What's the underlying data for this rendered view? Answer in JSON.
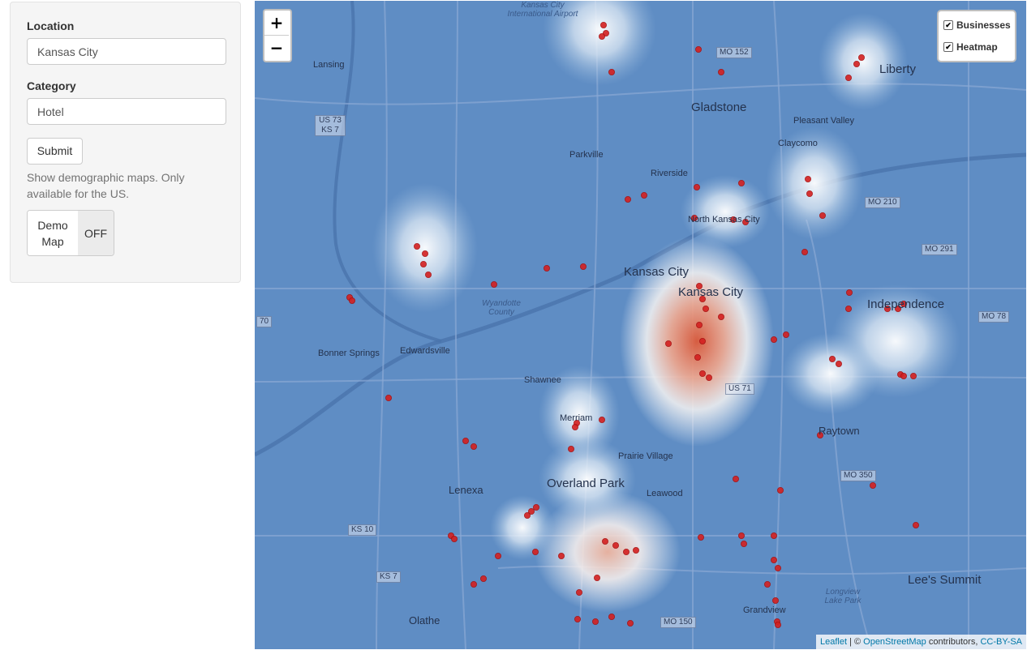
{
  "sidebar": {
    "location_label": "Location",
    "location_value": "Kansas City",
    "category_label": "Category",
    "category_value": "Hotel",
    "submit_label": "Submit",
    "help_text": "Show demographic maps. Only available for the US.",
    "toggle_on_label": "Demo Map",
    "toggle_off_label": "OFF"
  },
  "map": {
    "zoom_in": "+",
    "zoom_out": "−",
    "layers": [
      {
        "label": "Businesses",
        "checked": true
      },
      {
        "label": "Heatmap",
        "checked": true
      }
    ],
    "attribution": {
      "leaflet": "Leaflet",
      "sep": " | © ",
      "osm": "OpenStreetMap",
      "contrib": " contributors, ",
      "license": "CC-BY-SA"
    },
    "places": [
      "Kansas City",
      "Kansas City",
      "North Kansas City",
      "Gladstone",
      "Liberty",
      "Pleasant Valley",
      "Claycomo",
      "Riverside",
      "Parkville",
      "Independence",
      "Raytown",
      "Lee's Summit",
      "Grandview",
      "Leawood",
      "Overland Park",
      "Prairie Village",
      "Merriam",
      "Shawnee",
      "Lenexa",
      "Olathe",
      "Edwardsville",
      "Bonner Springs",
      "Lansing",
      "Wyandotte County",
      "Kansas City International Airport",
      "Longview Lake Park"
    ],
    "route_shields": [
      "MO 152",
      "MO 210",
      "MO 291",
      "MO 78",
      "MO 350",
      "MO 150",
      "US 73 KS 7",
      "KS 10",
      "KS 7",
      "US 71",
      "70"
    ],
    "colors": {
      "base": "#5f8dc4",
      "heat_low": "#ffffff",
      "heat_high": "#e0603a",
      "marker": "#d42020"
    }
  }
}
